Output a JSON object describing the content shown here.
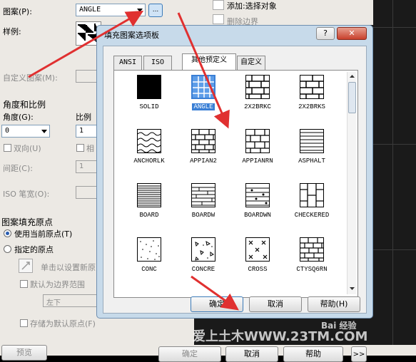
{
  "left_dialog": {
    "pattern_label": "图案(P):",
    "pattern_value": "ANGLE",
    "sample_label": "样例:",
    "custom_pattern_label": "自定义图案(M):",
    "angle_scale_header": "角度和比例",
    "angle_label": "角度(G):",
    "angle_value": "0",
    "scale_label": "比例",
    "scale_value": "1",
    "double_label": "双向(U)",
    "relative_label": "相",
    "spacing_label": "间距(C):",
    "spacing_value": "1",
    "iso_pen_label": "ISO 笔宽(O):",
    "origin_header": "图案填充原点",
    "use_current_origin": "使用当前原点(T)",
    "specified_origin": "指定的原点",
    "click_to_set": "单击以设置新原",
    "default_boundary": "默认为边界范围",
    "position_value": "左下",
    "store_default": "存储为默认原点(F)",
    "preview_btn": "预览"
  },
  "right_panel": {
    "add_select": "添加:选择对象",
    "remove_boundary": "删除边界"
  },
  "bottom_buttons": {
    "ok": "确定",
    "cancel": "取消",
    "help": "帮助"
  },
  "popup": {
    "title": "填充图案选项板",
    "help_btn": "?",
    "close_btn": "✕",
    "tabs": [
      "ANSI",
      "ISO",
      "其他预定义",
      "自定义"
    ],
    "active_tab": "其他预定义",
    "patterns": [
      "SOLID",
      "ANGLE",
      "2X2BRKC",
      "2X2BRKS",
      "ANCHORLK",
      "APPIAN2",
      "APPIANRN",
      "ASPHALT",
      "BOARD",
      "BOARDW",
      "BOARDWN",
      "CHECKERED",
      "CONC",
      "CONCRE",
      "CROSS",
      "CTYSQ6RN"
    ],
    "selected": "ANGLE",
    "ok": "确定",
    "cancel": "取消",
    "help": "帮助(H)"
  },
  "watermark": {
    "text1": "爱上土木WWW.23TM.COM",
    "text2": "Bai 经验"
  }
}
